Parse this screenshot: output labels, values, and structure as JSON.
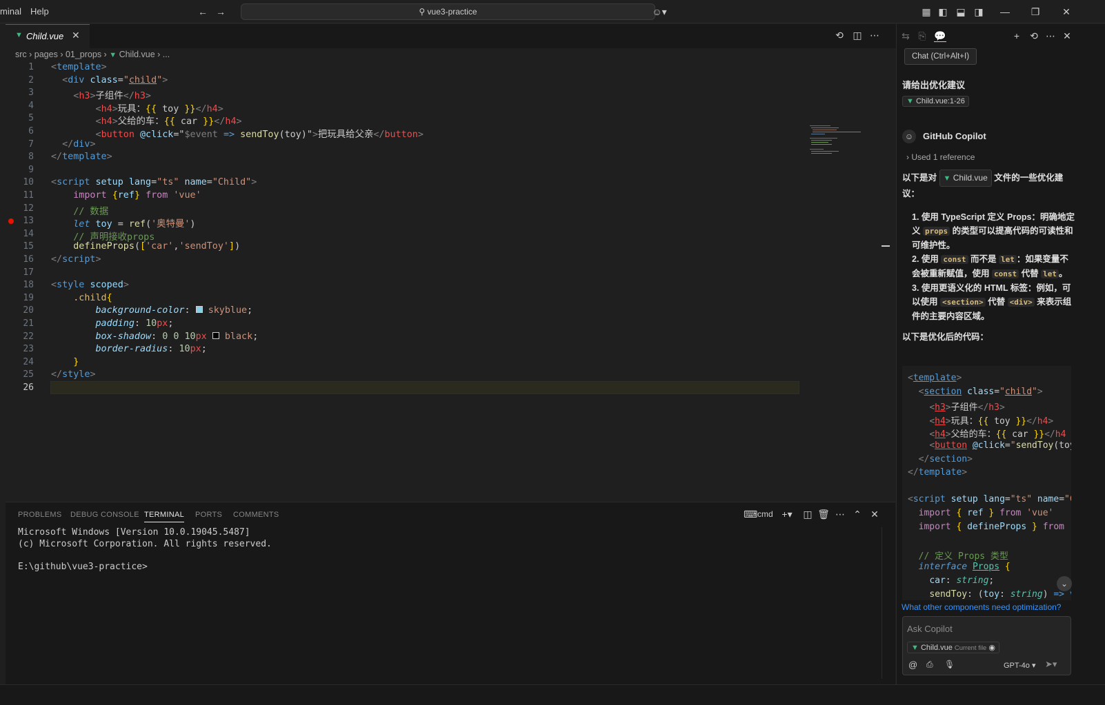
{
  "titlebar": {
    "menu_terminal": "minal",
    "menu_help": "Help",
    "search_text": "vue3-practice"
  },
  "editor": {
    "tab_label": "Child.vue",
    "breadcrumb": {
      "src": "src",
      "pages": "pages",
      "folder": "01_props",
      "file": "Child.vue",
      "more": "..."
    },
    "line_numbers": [
      "1",
      "2",
      "3",
      "4",
      "5",
      "6",
      "7",
      "8",
      "9",
      "10",
      "11",
      "12",
      "13",
      "14",
      "15",
      "16",
      "17",
      "18",
      "19",
      "20",
      "21",
      "22",
      "23",
      "24",
      "25",
      "26"
    ]
  },
  "panel": {
    "tabs": [
      "PROBLEMS",
      "DEBUG CONSOLE",
      "TERMINAL",
      "PORTS",
      "COMMENTS"
    ],
    "shell_label": "cmd",
    "terminal_lines": [
      "Microsoft Windows [Version 10.0.19045.5487]",
      "(c) Microsoft Corporation. All rights reserved.",
      "",
      "E:\\github\\vue3-practice>"
    ]
  },
  "chat": {
    "tooltip": "Chat (Ctrl+Alt+I)",
    "user_prompt": "请给出优化建议",
    "ref_chip": "Child.vue:1-26",
    "assistant_name": "GitHub Copilot",
    "used_reference": "Used 1 reference",
    "intro_before": "以下是对",
    "intro_chip": "Child.vue",
    "intro_after": "文件的一些优化建议：",
    "items": [
      {
        "num": "1.",
        "bold": "使用 TypeScript 定义 Props：",
        "t1": "明确地定义",
        "code1": "props",
        "t2": "的类型可以提高代码的可读性和可维护性。"
      },
      {
        "num": "2.",
        "bold": "使用",
        "code1": "const",
        "t1": "而不是",
        "code2": "let",
        "t2": "：如果变量不会被重新赋值，使用",
        "code3": "const",
        "t3": "代替",
        "code4": "let",
        "t4": "。"
      },
      {
        "num": "3.",
        "bold": "使用更语义化的 HTML 标签：",
        "t1": "例如，可以使用",
        "code1": "<section>",
        "t2": "代替",
        "code2": "<div>",
        "t3": "来表示组件的主要内容区域。"
      }
    ],
    "optimized_heading": "以下是优化后的代码：",
    "suggestion": "What other components need optimization?",
    "ask_placeholder": "Ask Copilot",
    "context_file": "Child.vue",
    "context_label": "Current file",
    "model": "GPT-4o"
  },
  "colors": {
    "accent": "#0078d4",
    "vue_green": "#41b883",
    "breakpoint": "#e51400"
  }
}
